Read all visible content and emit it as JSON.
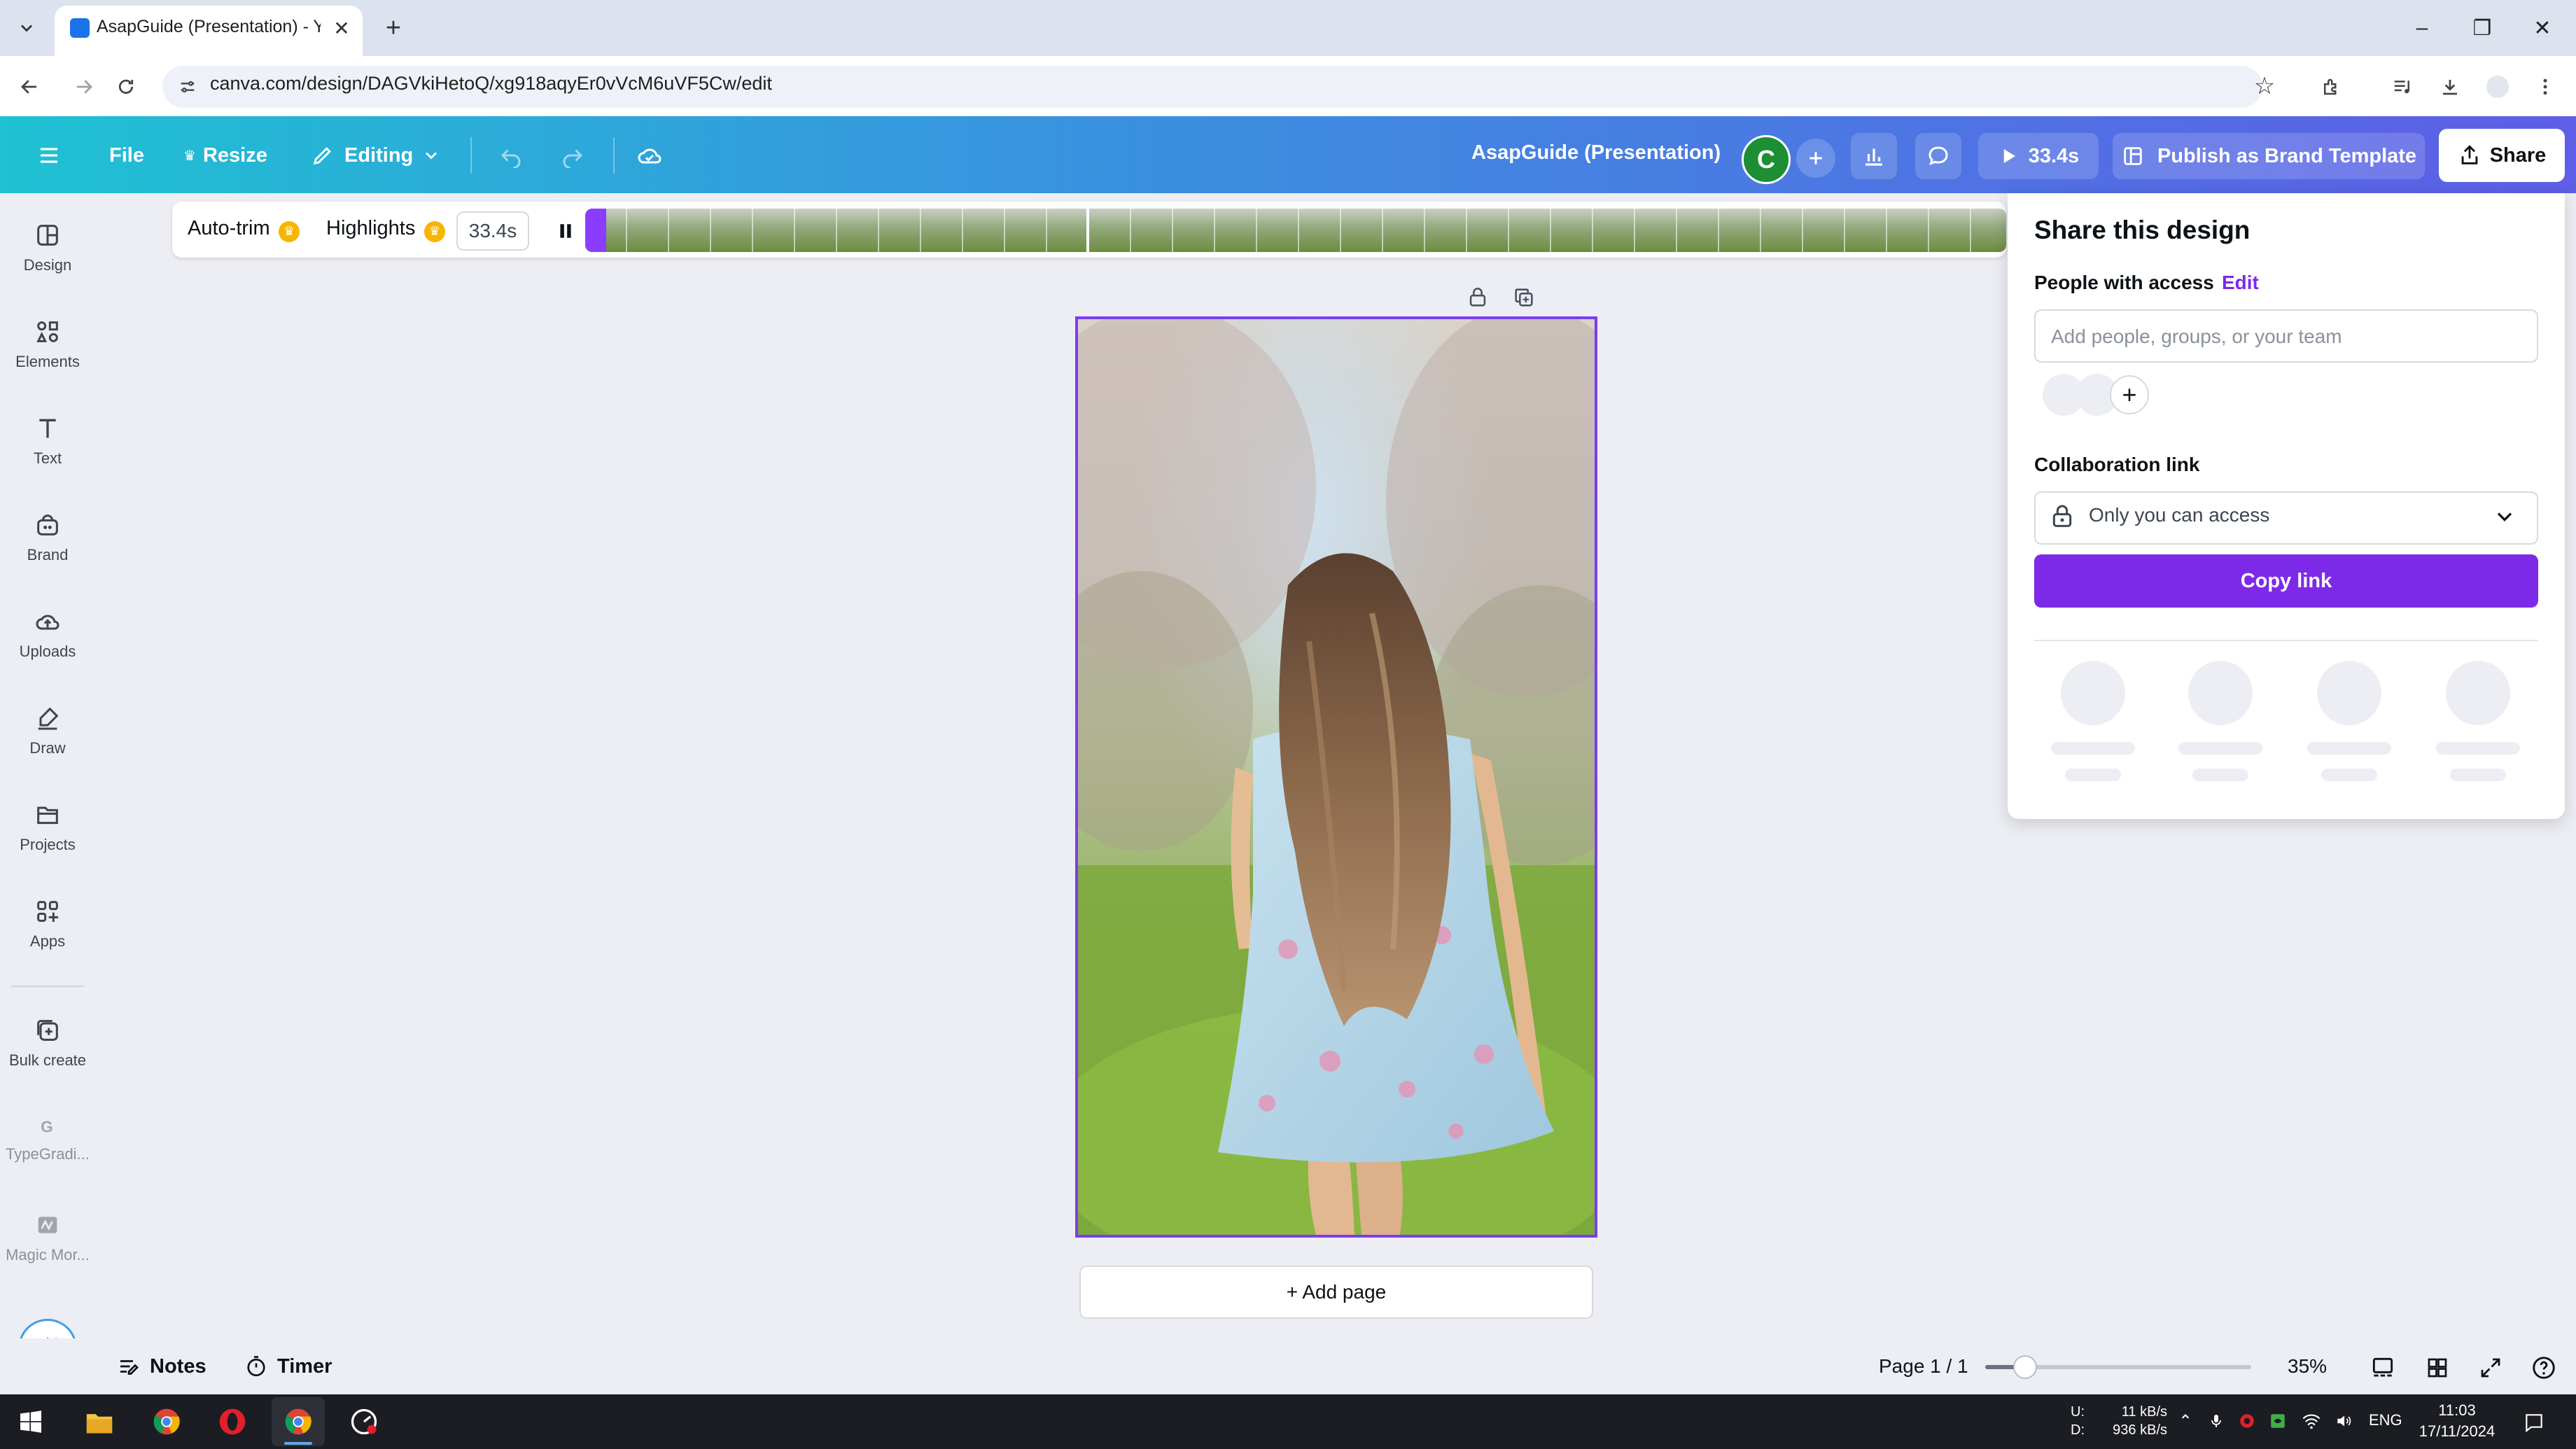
{
  "browser": {
    "tab_title": "AsapGuide (Presentation) - You",
    "url": "canva.com/design/DAGVkiHetoQ/xg918aqyEr0vVcM6uVF5Cw/edit"
  },
  "header": {
    "file_label": "File",
    "resize_label": "Resize",
    "editing_label": "Editing",
    "doc_title": "AsapGuide (Presentation)",
    "avatar_initial": "C",
    "present_duration": "33.4s",
    "publish_label": "Publish as Brand Template",
    "share_label": "Share",
    "brand_color": "#8b3dff"
  },
  "sidebar": {
    "items": [
      {
        "label": "Design",
        "icon": "design-icon"
      },
      {
        "label": "Elements",
        "icon": "elements-icon"
      },
      {
        "label": "Text",
        "icon": "text-icon"
      },
      {
        "label": "Brand",
        "icon": "brand-icon"
      },
      {
        "label": "Uploads",
        "icon": "uploads-icon"
      },
      {
        "label": "Draw",
        "icon": "draw-icon"
      },
      {
        "label": "Projects",
        "icon": "projects-icon"
      },
      {
        "label": "Apps",
        "icon": "apps-icon"
      },
      {
        "label": "Bulk create",
        "icon": "bulk-create-icon"
      },
      {
        "label": "TypeGradi...",
        "icon": "typegradient-icon"
      },
      {
        "label": "Magic Mor...",
        "icon": "magic-morph-icon"
      }
    ]
  },
  "timeline": {
    "autotrim_label": "Auto-trim",
    "highlights_label": "Highlights",
    "duration": "33.4s"
  },
  "canvas": {
    "add_page_label": "+ Add page"
  },
  "share_panel": {
    "title": "Share this design",
    "people_label": "People with access",
    "edit_label": "Edit",
    "people_placeholder": "Add people, groups, or your team",
    "collab_label": "Collaboration link",
    "access_value": "Only you can access",
    "copy_link_label": "Copy link",
    "accent_color": "#7d2ae8"
  },
  "bottom_bar": {
    "notes_label": "Notes",
    "timer_label": "Timer",
    "page_count": "Page 1 / 1",
    "zoom_value": "35%",
    "zoom_fraction": 0.15
  },
  "taskbar": {
    "net_up_label": "U:",
    "net_down_label": "D:",
    "net_up": "11 kB/s",
    "net_down": "936 kB/s",
    "language": "ENG",
    "time": "11:03",
    "date": "17/11/2024"
  }
}
